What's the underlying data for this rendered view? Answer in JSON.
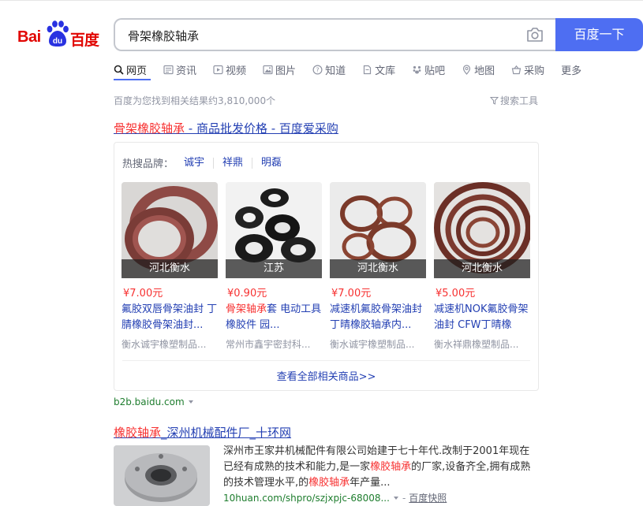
{
  "header": {
    "logo_text_latin": "Bai",
    "logo_text_paw": "du",
    "logo_text_cn": "百度",
    "search_query": "骨架橡胶轴承",
    "search_button": "百度一下"
  },
  "tabs": [
    {
      "label": "网页",
      "icon": "search-icon"
    },
    {
      "label": "资讯",
      "icon": "news-icon"
    },
    {
      "label": "视频",
      "icon": "video-icon"
    },
    {
      "label": "图片",
      "icon": "image-icon"
    },
    {
      "label": "知道",
      "icon": "question-icon"
    },
    {
      "label": "文库",
      "icon": "document-icon"
    },
    {
      "label": "贴吧",
      "icon": "tieba-icon"
    },
    {
      "label": "地图",
      "icon": "map-pin-icon"
    },
    {
      "label": "采购",
      "icon": "basket-icon"
    },
    {
      "label": "更多",
      "icon": ""
    }
  ],
  "result_count": "百度为您找到相关结果约3,810,000个",
  "search_tools": "搜索工具",
  "result1": {
    "title_highlight": "骨架橡胶轴承",
    "title_rest": " - 商品批发价格 - 百度爱采购",
    "brands_label": "热搜品牌：",
    "brands": [
      "诚宇",
      "祥鼎",
      "明磊"
    ],
    "products": [
      {
        "location": "河北衡水",
        "price": "¥7.00元",
        "name": "氟胶双唇骨架油封 丁腈橡胶骨架油封...",
        "shop": "衡水诚宇橡塑制品..."
      },
      {
        "location": "江苏",
        "price": "¥0.90元",
        "name_hl": "骨架轴承",
        "name_rest": "套 电动工具橡胶件 园...",
        "shop": "常州市鑫宇密封科..."
      },
      {
        "location": "河北衡水",
        "price": "¥7.00元",
        "name": "减速机氟胶骨架油封 丁晴橡胶轴承内...",
        "shop": "衡水诚宇橡塑制品..."
      },
      {
        "location": "河北衡水",
        "price": "¥5.00元",
        "name": "减速机NOK氟胶骨架油封 CFW丁晴橡",
        "shop": "衡水祥鼎橡塑制品..."
      }
    ],
    "view_all": "查看全部相关商品>>",
    "source": "b2b.baidu.com"
  },
  "result2": {
    "title_highlight": "橡胶轴承",
    "title_rest": "_深州机械配件厂_十环网",
    "abstract_a": "深州市王家井机械配件有限公司始建于七十年代.改制于2001年现在已经有成熟的技术和能力,是一家",
    "abstract_hl1": "橡胶轴承",
    "abstract_b": "的厂家,设备齐全,拥有成熟的技术管理水平,的",
    "abstract_hl2": "橡胶轴承",
    "abstract_c": "年产量...",
    "url": "10huan.com/shpro/szjxpjc-68008...",
    "separator": "-",
    "snapshot": "百度快照"
  },
  "colors": {
    "brand_red": "#e10602",
    "brand_blue": "#2932e1",
    "search_button": "#4e6ef2",
    "link": "#2440b3",
    "highlight": "#f73131",
    "url_green": "#1e7d2e",
    "muted": "#9195a3"
  }
}
